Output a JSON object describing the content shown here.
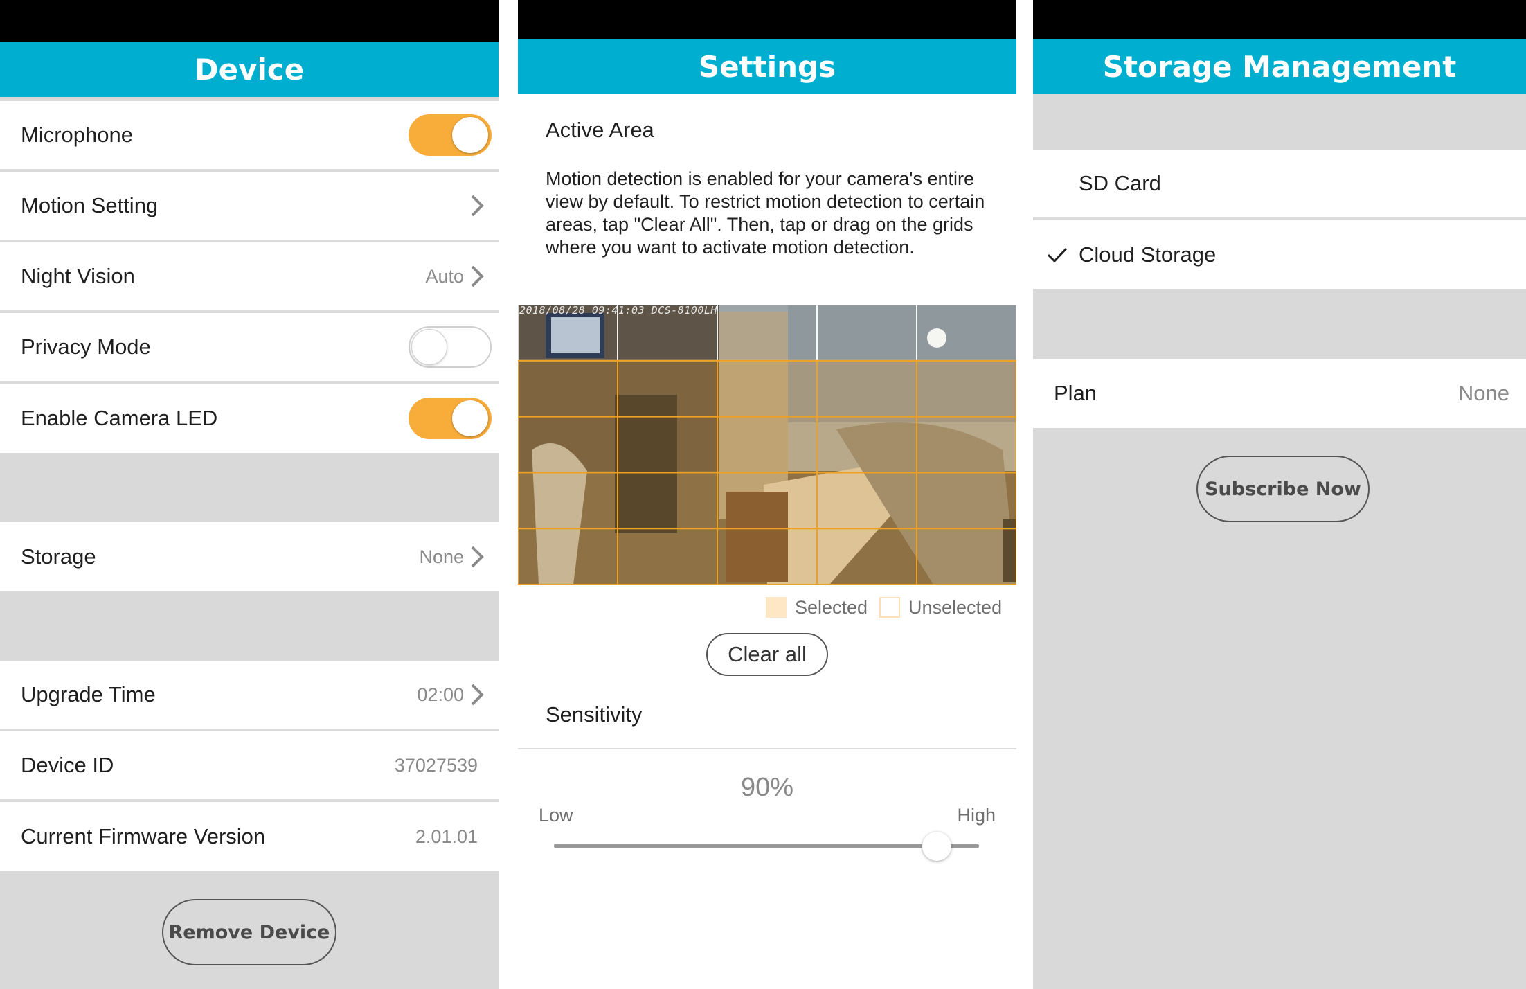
{
  "device_panel": {
    "title": "Device",
    "rows": [
      {
        "label": "Microphone",
        "toggle": "on"
      },
      {
        "label": "Motion Setting"
      },
      {
        "label": "Night Vision",
        "value": "Auto"
      },
      {
        "label": "Privacy Mode",
        "toggle": "off"
      },
      {
        "label": "Enable Camera LED",
        "toggle": "on"
      }
    ],
    "storage": {
      "label": "Storage",
      "value": "None"
    },
    "info_rows": [
      {
        "label": "Upgrade Time",
        "value": "02:00"
      },
      {
        "label": "Device ID",
        "value": "37027539"
      },
      {
        "label": "Current Firmware Version",
        "value": "2.01.01"
      }
    ],
    "remove_button": "Remove Device"
  },
  "settings_panel": {
    "title": "Settings",
    "active_area_heading": "Active Area",
    "description": "Motion detection is enabled for your camera's entire view by default. To restrict motion detection to certain areas, tap \"Clear All\". Then, tap or drag on the grids where you want to activate motion detection.",
    "camera_timestamp": "2018/08/28 09:41:03 DCS-8100LH",
    "grid": {
      "columns": 5,
      "rows": 5,
      "selected_rows": [
        1,
        2,
        3,
        4
      ]
    },
    "legend": {
      "selected": "Selected",
      "unselected": "Unselected"
    },
    "clear_button": "Clear all",
    "sensitivity_heading": "Sensitivity",
    "sensitivity_value": "90%",
    "sensitivity_level": 0.9,
    "low_label": "Low",
    "high_label": "High"
  },
  "storage_panel": {
    "title": "Storage Management",
    "options": [
      {
        "label": "SD Card",
        "checked": false
      },
      {
        "label": "Cloud Storage",
        "checked": true
      }
    ],
    "plan": {
      "label": "Plan",
      "value": "None"
    },
    "subscribe_button": "Subscribe Now"
  },
  "colors": {
    "accent": "#00aed0",
    "toggle_on": "#f8ad3b",
    "grid_line": "#f0a020"
  }
}
